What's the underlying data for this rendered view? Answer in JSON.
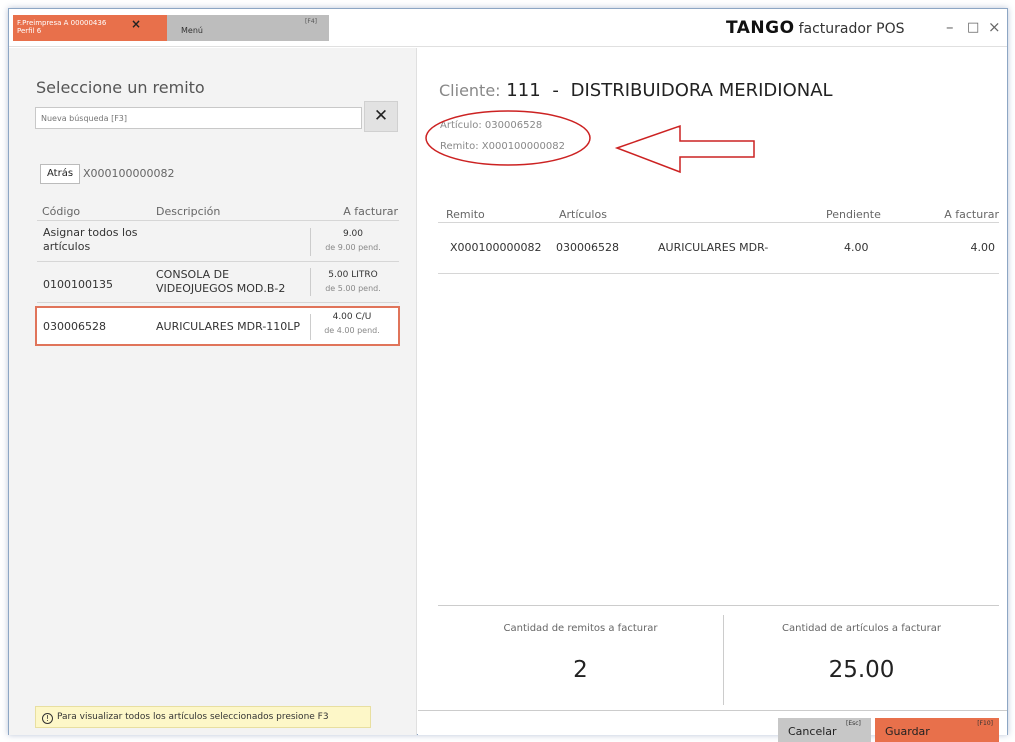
{
  "titlebar": {
    "tab_active_line1": "F.Preimpresa A 00000436",
    "tab_active_line2": "Perfil 6",
    "tab_close": "×",
    "tab_menu_label": "Menú",
    "tab_menu_key": "[F4]",
    "brand_logo": "TANGO",
    "brand_sub": "facturador POS",
    "win_min": "–",
    "win_max": "□",
    "win_close": "×"
  },
  "left": {
    "title": "Seleccione un remito",
    "search_placeholder": "Nueva búsqueda [F3]",
    "clear": "✕",
    "back_label": "Atrás",
    "back_path": "X000100000082",
    "columns": {
      "code": "Código",
      "desc": "Descripción",
      "fact": "A facturar"
    },
    "rows": [
      {
        "code": "Asignar todos los artículos",
        "desc": "",
        "qty": "9.00",
        "pend": "de 9.00 pend."
      },
      {
        "code": "0100100135",
        "desc": "CONSOLA DE VIDEOJUEGOS MOD.B-2",
        "qty": "5.00 LITRO",
        "pend": "de 5.00 pend."
      },
      {
        "code": "030006528",
        "desc": "AURICULARES MDR-110LP",
        "qty": "4.00 C/U",
        "pend": "de 4.00 pend."
      }
    ],
    "hint_icon": "!",
    "hint": "Para visualizar todos los artículos seleccionados presione F3"
  },
  "right": {
    "client_label": "Cliente:",
    "client_code": "111",
    "client_sep": "-",
    "client_name": "DISTRIBUIDORA MERIDIONAL",
    "articulo": "Artículo: 030006528",
    "remito": "Remito:  X000100000082",
    "columns": {
      "remito": "Remito",
      "articulos": "Artículos",
      "pendiente": "Pendiente",
      "fact": "A facturar"
    },
    "row": {
      "remito": "X000100000082",
      "articulo": "030006528",
      "desc": "AURICULARES MDR-",
      "pendiente": "4.00",
      "fact": "4.00"
    },
    "tot_remitos_label": "Cantidad de remitos a facturar",
    "tot_remitos": "2",
    "tot_articulos_label": "Cantidad de artículos a facturar",
    "tot_articulos": "25.00",
    "cancel_label": "Cancelar",
    "cancel_key": "[Esc]",
    "save_label": "Guardar",
    "save_key": "[F10]"
  },
  "colors": {
    "accent": "#e8704b",
    "annotation": "#cc2222",
    "hint_bg": "#fdf7c8"
  }
}
